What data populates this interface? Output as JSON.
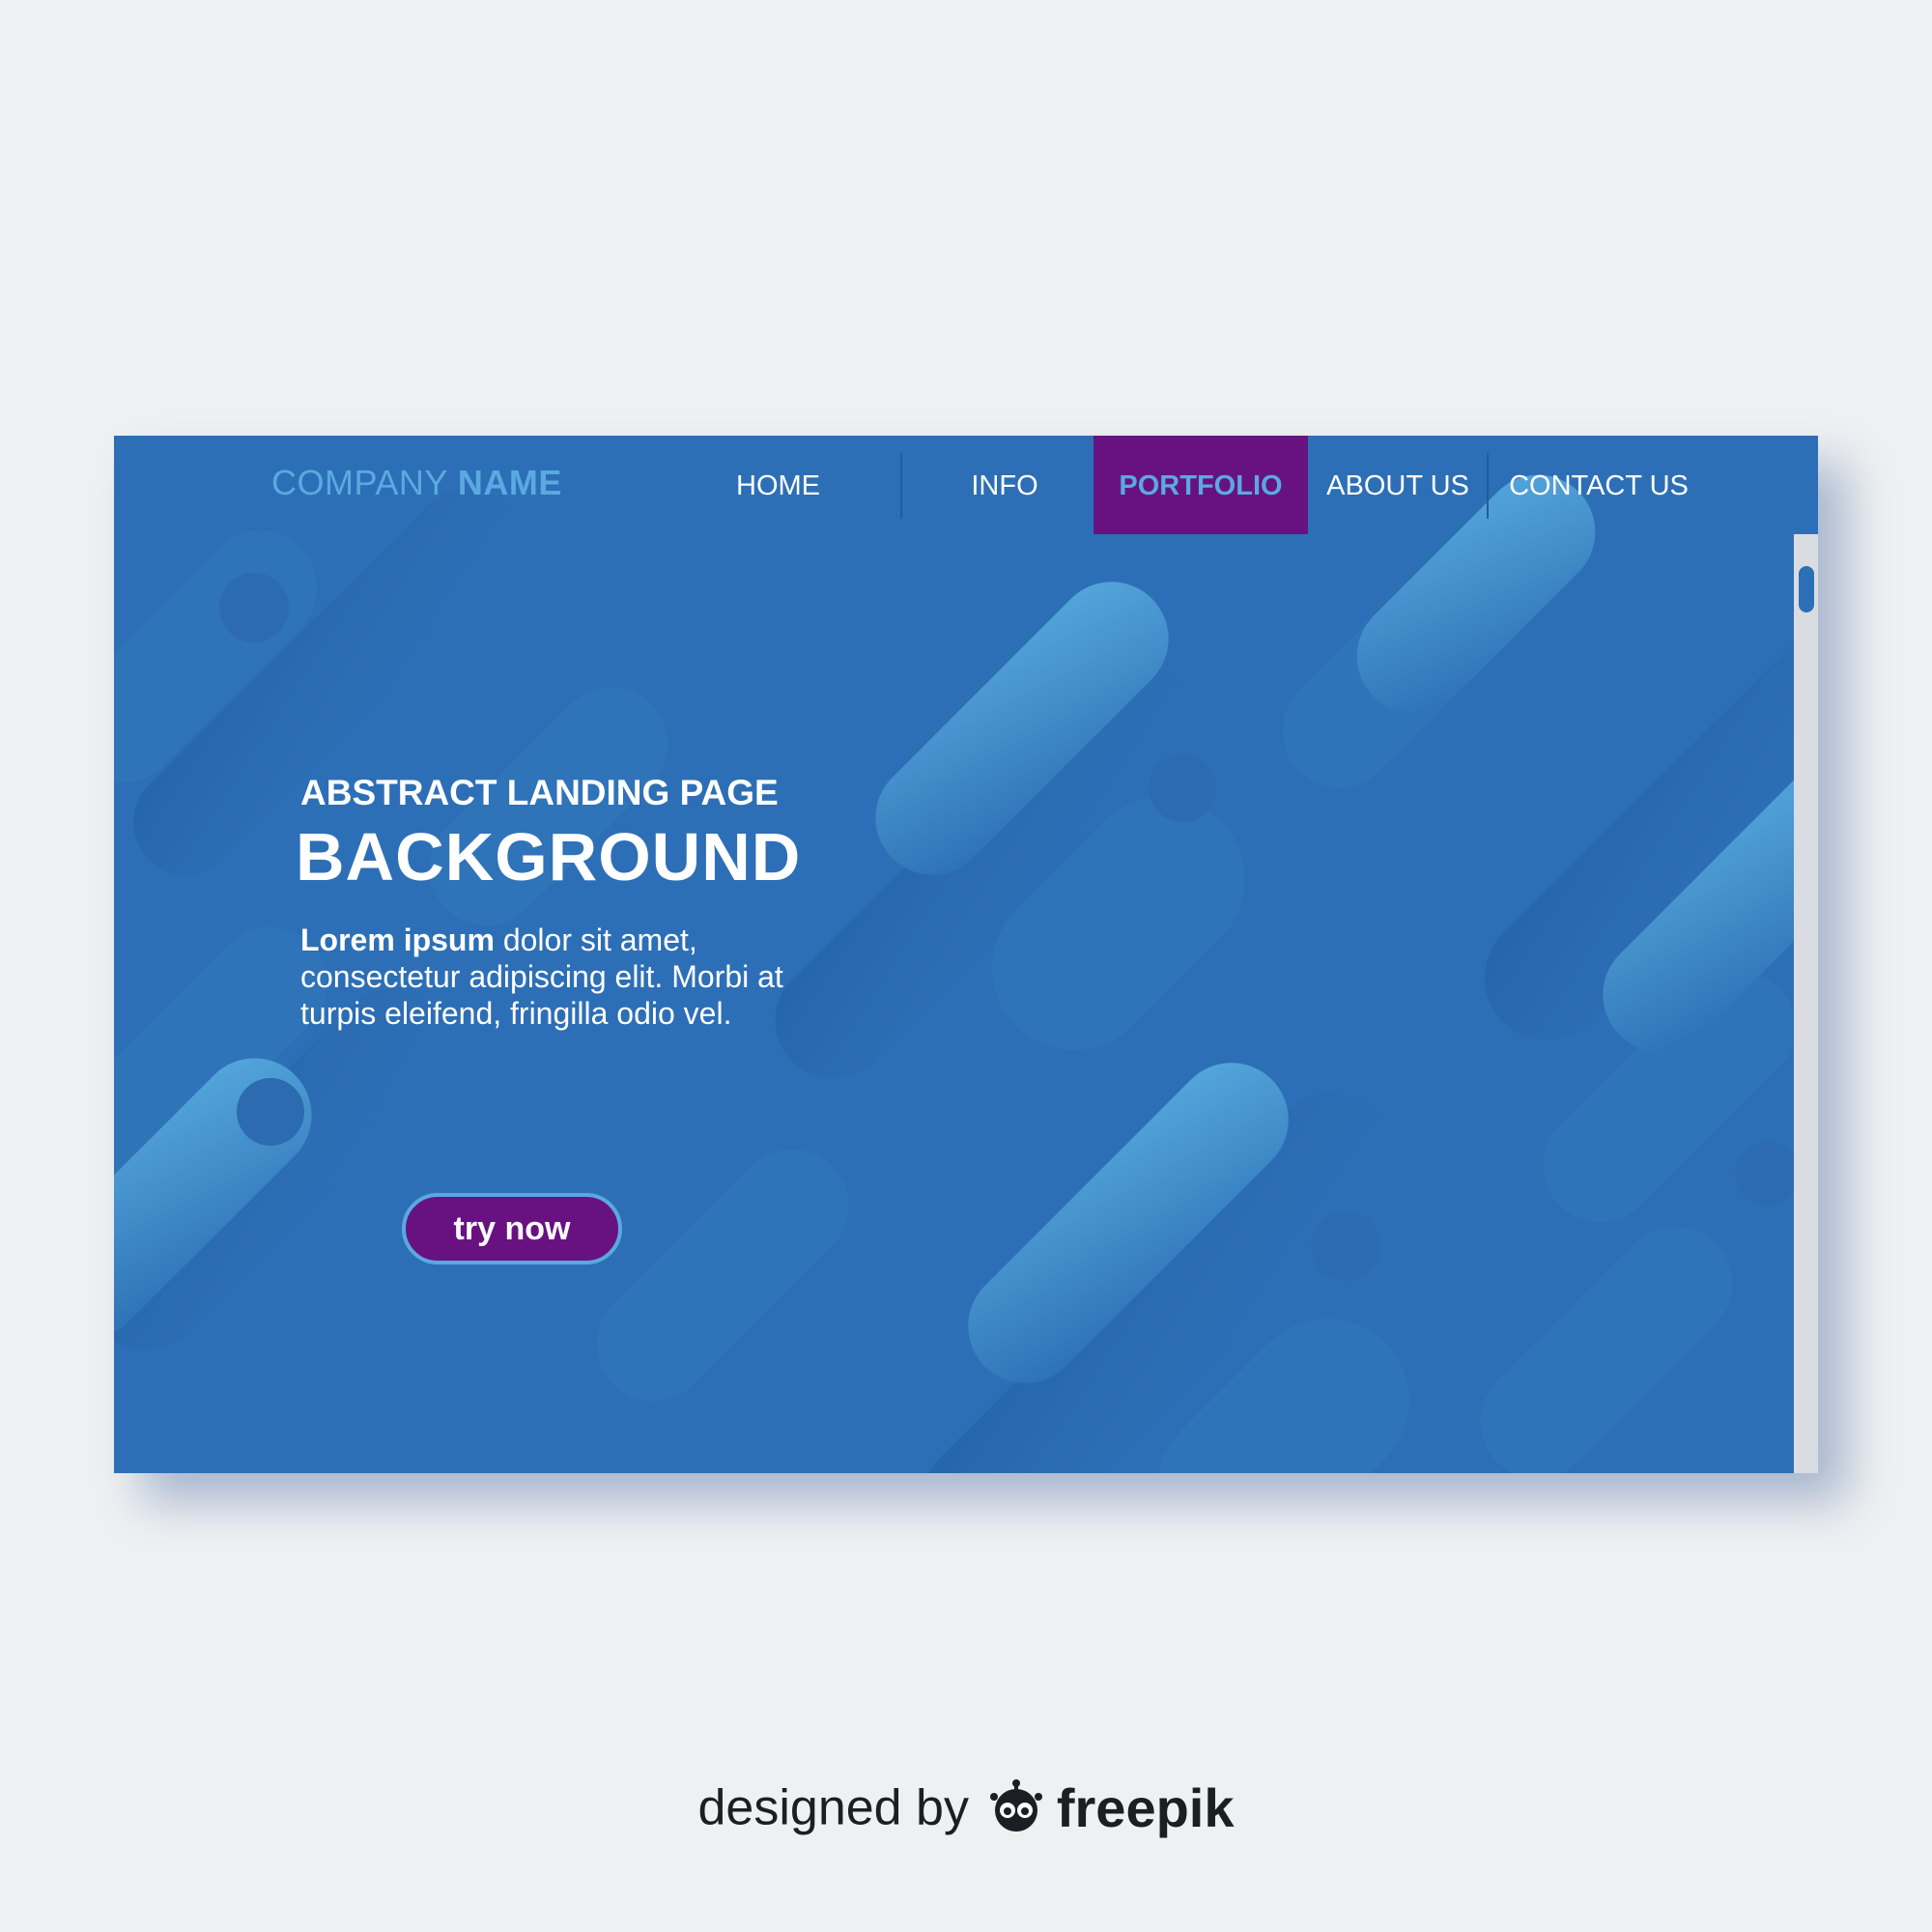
{
  "colors": {
    "page_background": "#eff0f2",
    "card_blue": "#2d6fb6",
    "accent_light_blue": "#5aa9e0",
    "active_purple": "#681281",
    "text_white": "#ffffff",
    "scrollbar_track": "#d9dde3"
  },
  "header": {
    "logo_light": "COMPANY",
    "logo_strong": "NAME",
    "nav": [
      {
        "label": "HOME",
        "active": false
      },
      {
        "label": "INFO",
        "active": false
      },
      {
        "label": "PORTFOLIO",
        "active": true
      },
      {
        "label": "ABOUT US",
        "active": false
      },
      {
        "label": "CONTACT US",
        "active": false
      }
    ]
  },
  "hero": {
    "subtitle": "ABSTRACT LANDING PAGE",
    "title": "BACKGROUND",
    "body_strong": "Lorem ipsum",
    "body_rest": " dolor sit amet, consectetur adipiscing elit. Morbi at turpis eleifend, fringilla odio vel.",
    "cta_label": "try now"
  },
  "footer": {
    "credit_text": "designed by",
    "brand_name": "freepik",
    "brand_icon": "freepik-logo-icon"
  }
}
